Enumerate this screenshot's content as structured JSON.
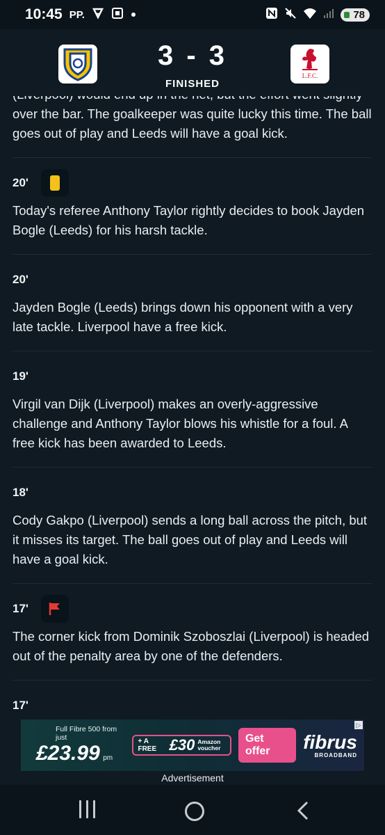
{
  "status_bar": {
    "time": "10:45",
    "carrier_tag": "PP.",
    "battery": "78"
  },
  "match": {
    "home_team": "Leeds",
    "away_team": "Liverpool",
    "home_crest_label": "",
    "away_crest_label": "L.F.C.",
    "score": "3 - 3",
    "status": "FINISHED"
  },
  "feed": [
    {
      "minute": "",
      "icon": "",
      "text": "(Liverpool) would end up in the net, but the effort went slightly over the bar. The goalkeeper was quite lucky this time. The ball goes out of play and Leeds will have a goal kick."
    },
    {
      "minute": "20'",
      "icon": "yellow-card-icon",
      "text": "Today's referee Anthony Taylor rightly decides to book Jayden Bogle (Leeds) for his harsh tackle."
    },
    {
      "minute": "20'",
      "icon": "",
      "text": "Jayden Bogle (Leeds) brings down his opponent with a very late tackle. Liverpool have a free kick."
    },
    {
      "minute": "19'",
      "icon": "",
      "text": "Virgil van Dijk (Liverpool) makes an overly-aggressive challenge and Anthony Taylor blows his whistle for a foul. A free kick has been awarded to Leeds."
    },
    {
      "minute": "18'",
      "icon": "",
      "text": "Cody Gakpo (Liverpool) sends a long ball across the pitch, but it misses its target. The ball goes out of play and Leeds will have a goal kick."
    },
    {
      "minute": "17'",
      "icon": "corner-flag-icon",
      "text": "The corner kick from Dominik Szoboszlai (Liverpool) is headed out of the penalty area by one of the defenders."
    },
    {
      "minute": "17'",
      "icon": "",
      "text": ""
    }
  ],
  "ad": {
    "small_text": "Full Fibre 500 from just",
    "price": "£23.99",
    "per": "pm",
    "voucher_prefix": "+ A FREE",
    "voucher_amount": "£30",
    "voucher_suffix": "Amazon voucher",
    "cta": "Get offer",
    "brand": "fibrus",
    "brand_sub": "BROADBAND",
    "label": "Advertisement"
  },
  "colors": {
    "background": "#0f1a22",
    "yellow_card": "#f2c21b",
    "corner_flag": "#e53935",
    "ad_accent": "#e8508b"
  }
}
